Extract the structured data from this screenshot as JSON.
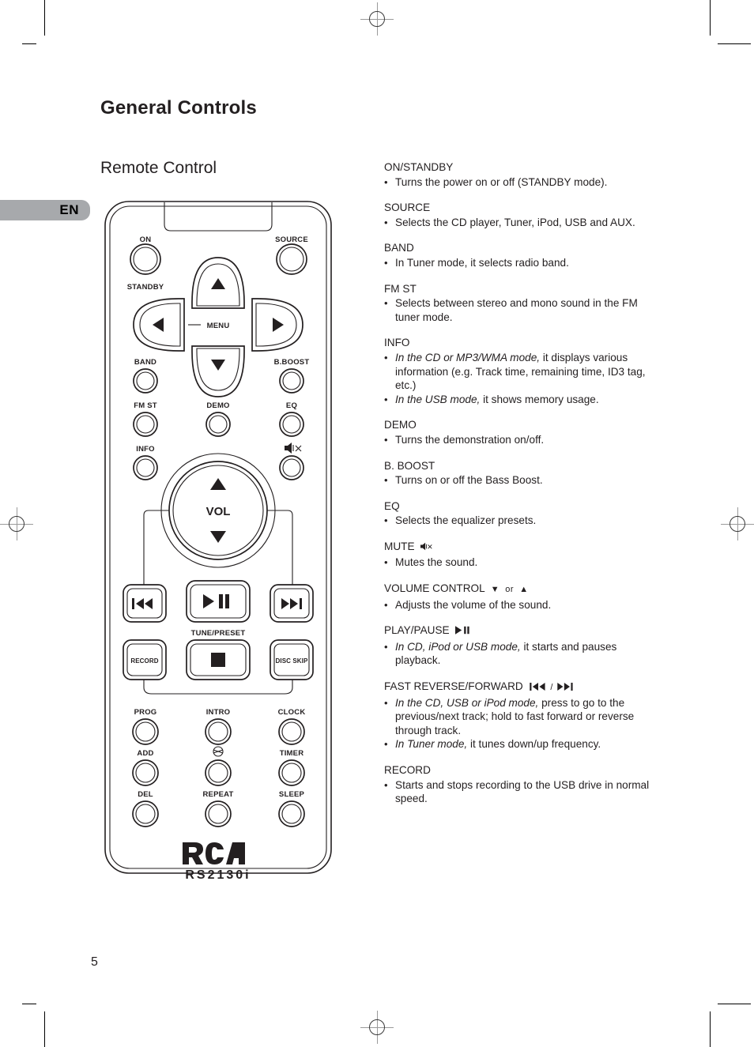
{
  "page": {
    "section_title": "General Controls",
    "subsection_title": "Remote Control",
    "language_tab": "EN",
    "page_number": "5"
  },
  "remote": {
    "brand": "RCA",
    "model": "RS2130i",
    "labels": {
      "on": "ON",
      "standby": "STANDBY",
      "source": "SOURCE",
      "menu": "MENU",
      "band": "BAND",
      "bboost": "B.BOOST",
      "fmst": "FM ST",
      "demo": "DEMO",
      "eq": "EQ",
      "info": "INFO",
      "mute": "MUTE",
      "vol": "VOL",
      "tune_preset": "TUNE/PRESET",
      "record": "RECORD",
      "disc_skip": "DISC SKIP",
      "prog": "PROG",
      "intro": "INTRO",
      "clock": "CLOCK",
      "add": "ADD",
      "timer": "TIMER",
      "del": "DEL",
      "repeat": "REPEAT",
      "sleep": "SLEEP"
    }
  },
  "descriptions": [
    {
      "title": "ON/STANDBY",
      "items": [
        {
          "lead": "",
          "rest": "Turns the power on or off (STANDBY mode)."
        }
      ]
    },
    {
      "title": "SOURCE",
      "items": [
        {
          "lead": "",
          "rest": "Selects the CD player, Tuner, iPod, USB and AUX."
        }
      ]
    },
    {
      "title": "BAND",
      "items": [
        {
          "lead": "",
          "rest": "In Tuner mode, it selects radio band."
        }
      ]
    },
    {
      "title": "FM ST",
      "items": [
        {
          "lead": "",
          "rest": "Selects between stereo and mono sound in the FM tuner mode."
        }
      ]
    },
    {
      "title": "INFO",
      "items": [
        {
          "lead": "In the CD or MP3/WMA mode,",
          "rest": " it displays various information (e.g. Track time, remaining time, ID3 tag, etc.)"
        },
        {
          "lead": "In the USB mode,",
          "rest": " it shows memory usage."
        }
      ]
    },
    {
      "title": "DEMO",
      "items": [
        {
          "lead": "",
          "rest": "Turns the demonstration on/off."
        }
      ]
    },
    {
      "title": "B. BOOST",
      "items": [
        {
          "lead": "",
          "rest": "Turns on or off the Bass Boost."
        }
      ]
    },
    {
      "title": "EQ",
      "items": [
        {
          "lead": "",
          "rest": "Selects the equalizer presets."
        }
      ]
    },
    {
      "title": "MUTE",
      "icon": "mute-icon",
      "items": [
        {
          "lead": "",
          "rest": "Mutes the sound."
        }
      ]
    },
    {
      "title": "VOLUME CONTROL",
      "icon": "volume-down-up-icon",
      "items": [
        {
          "lead": "",
          "rest": "Adjusts the volume of the sound."
        }
      ]
    },
    {
      "title": "PLAY/PAUSE",
      "icon": "play-pause-icon",
      "items": [
        {
          "lead": "In CD, iPod or USB mode,",
          "rest": " it starts and pauses playback."
        }
      ]
    },
    {
      "title": "FAST REVERSE/FORWARD",
      "icon": "prev-next-icon",
      "items": [
        {
          "lead": "In the CD, USB or iPod mode,",
          "rest": " press to go to the previous/next track; hold to fast forward or reverse through track."
        },
        {
          "lead": "In Tuner mode,",
          "rest": " it tunes down/up frequency."
        }
      ]
    },
    {
      "title": "RECORD",
      "items": [
        {
          "lead": "",
          "rest": "Starts and stops recording to the USB drive in normal speed."
        }
      ]
    }
  ],
  "icons": {
    "mute": "⌨×",
    "volume_down": "▼",
    "volume_up": "▲",
    "or": "or",
    "play": "▶",
    "pause": "❙❙",
    "prev": "⏮",
    "next": "⏭",
    "slash": "/"
  },
  "colors": {
    "text": "#231f20",
    "tab_bg": "#a7a9ac",
    "line": "#000000"
  }
}
